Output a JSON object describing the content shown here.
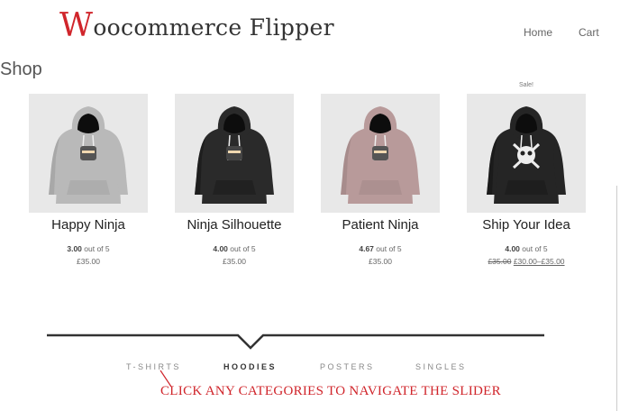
{
  "header": {
    "logo_first": "W",
    "logo_rest": "oocommerce Flipper",
    "nav": [
      {
        "label": "Home"
      },
      {
        "label": "Cart"
      }
    ]
  },
  "shop_title": "Shop",
  "products": [
    {
      "name": "Happy Ninja",
      "rating_value": "3.00",
      "rating_suffix": "out of 5",
      "price": "£35.00",
      "hoodie_color": "#b9b9b9",
      "sale": false
    },
    {
      "name": "Ninja Silhouette",
      "rating_value": "4.00",
      "rating_suffix": "out of 5",
      "price": "£35.00",
      "hoodie_color": "#2a2a2a",
      "sale": false
    },
    {
      "name": "Patient Ninja",
      "rating_value": "4.67",
      "rating_suffix": "out of 5",
      "price": "£35.00",
      "hoodie_color": "#b89a9a",
      "sale": false
    },
    {
      "name": "Ship Your Idea",
      "rating_value": "4.00",
      "rating_suffix": "out of 5",
      "price_old": "£35.00",
      "price_new": "£30.00–£35.00",
      "hoodie_color": "#252525",
      "sale": true,
      "sale_label": "Sale!"
    }
  ],
  "categories": [
    {
      "label": "T-SHIRTS",
      "active": false
    },
    {
      "label": "HOODIES",
      "active": true
    },
    {
      "label": "POSTERS",
      "active": false
    },
    {
      "label": "SINGLES",
      "active": false
    }
  ],
  "annotation": "CLICK ANY CATEGORIES TO NAVIGATE THE SLIDER",
  "colors": {
    "brand_red": "#d0252b",
    "divider": "#333333"
  }
}
